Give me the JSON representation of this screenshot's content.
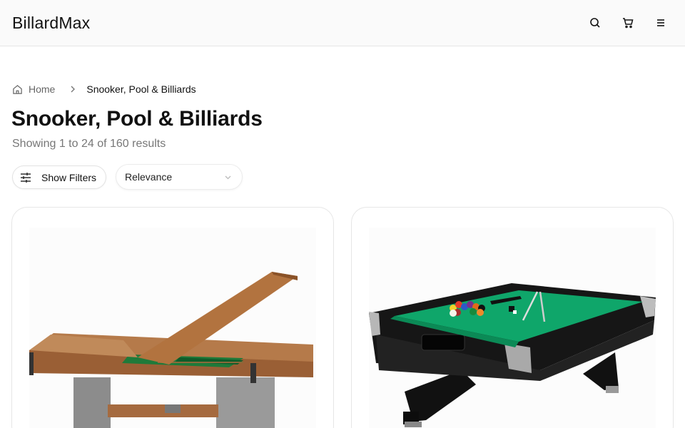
{
  "header": {
    "logo": "BillardMax",
    "icons": [
      "search-icon",
      "cart-icon",
      "menu-icon"
    ]
  },
  "breadcrumb": {
    "home": "Home",
    "current": "Snooker, Pool & Billiards"
  },
  "page": {
    "title": "Snooker, Pool & Billiards",
    "result_count": "Showing 1 to 24 of 160 results"
  },
  "toolbar": {
    "filter_label": "Show Filters",
    "sort_value": "Relevance"
  },
  "products": [
    {
      "image": "convertible-dining-pool-table"
    },
    {
      "image": "black-pool-table-green-felt"
    }
  ],
  "colors": {
    "felt": "#1a9a5c",
    "wood": "#a4673a",
    "text_muted": "#777777"
  }
}
